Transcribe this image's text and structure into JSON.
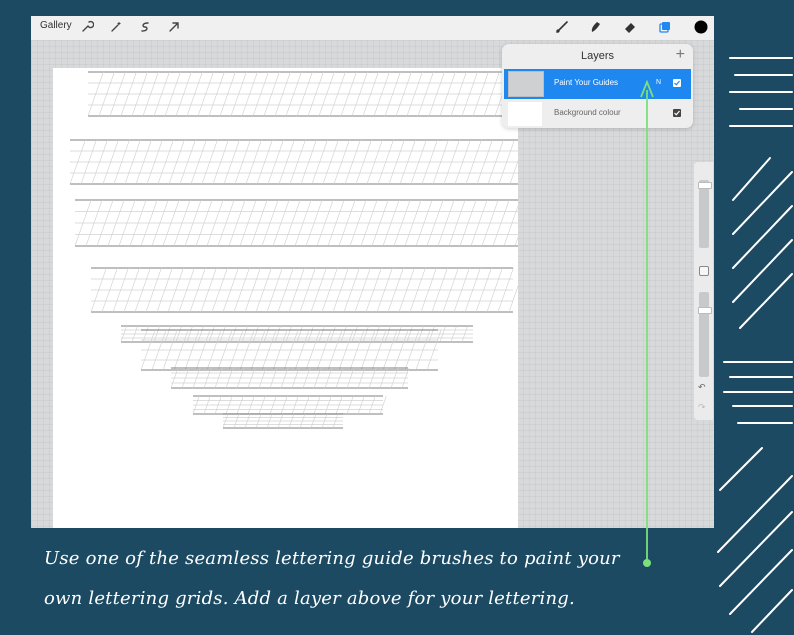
{
  "toolbar": {
    "gallery_label": "Gallery",
    "color_swatch": "#000000",
    "active_color": "#1f87f0"
  },
  "layers_panel": {
    "title": "Layers",
    "add_symbol": "+",
    "layers": [
      {
        "name": "Paint Your Guides",
        "blend": "N",
        "visible": true,
        "active": true
      },
      {
        "name": "Background colour",
        "visible": true,
        "active": false
      }
    ]
  },
  "sidebar": {
    "undo_symbol": "↶",
    "redo_symbol": "↷"
  },
  "annotation": {
    "line1": "Use one of the seamless lettering guide brushes to paint your",
    "line2": "own lettering grids. Add a layer above for your lettering.",
    "pointer_color": "#7be07b"
  }
}
